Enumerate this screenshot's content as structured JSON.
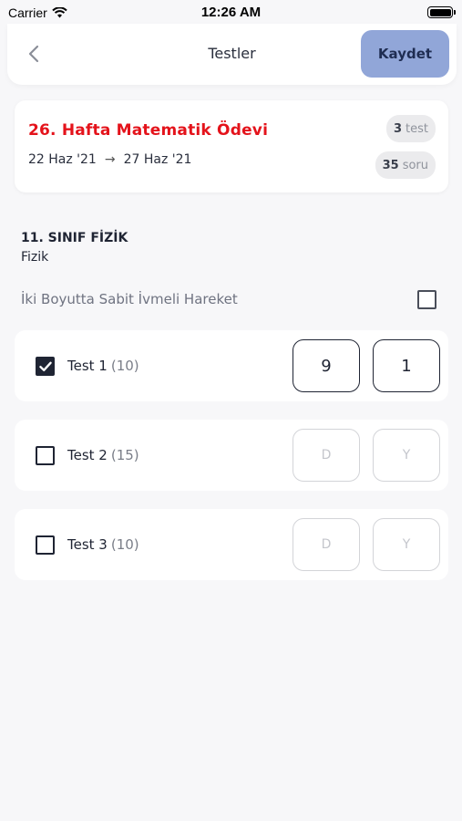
{
  "status_bar": {
    "carrier": "Carrier",
    "time": "12:26 AM"
  },
  "nav": {
    "title": "Testler",
    "save_label": "Kaydet",
    "back_icon": "chevron-left-icon"
  },
  "homework": {
    "title": "26. Hafta Matematik Ödevi",
    "start_date": "22 Haz '21",
    "arrow": "→",
    "end_date": "27 Haz '21",
    "test_count": "3",
    "test_unit": "test",
    "question_count": "35",
    "question_unit": "soru"
  },
  "section": {
    "title": "11. SINIF FİZİK",
    "subtitle": "Fizik"
  },
  "topic": {
    "label": "İki Boyutta Sabit İvmeli Hareket",
    "checked": false
  },
  "tests": [
    {
      "name": "Test 1",
      "count": "(10)",
      "checked": true,
      "correct": "9",
      "wrong": "1"
    },
    {
      "name": "Test 2",
      "count": "(15)",
      "checked": false,
      "correct_placeholder": "D",
      "wrong_placeholder": "Y"
    },
    {
      "name": "Test 3",
      "count": "(10)",
      "checked": false,
      "correct_placeholder": "D",
      "wrong_placeholder": "Y"
    }
  ],
  "colors": {
    "accent_button": "#91a6d8",
    "homework_title": "#e4131b",
    "dark": "#1f2433",
    "background": "#f7f7f9"
  }
}
